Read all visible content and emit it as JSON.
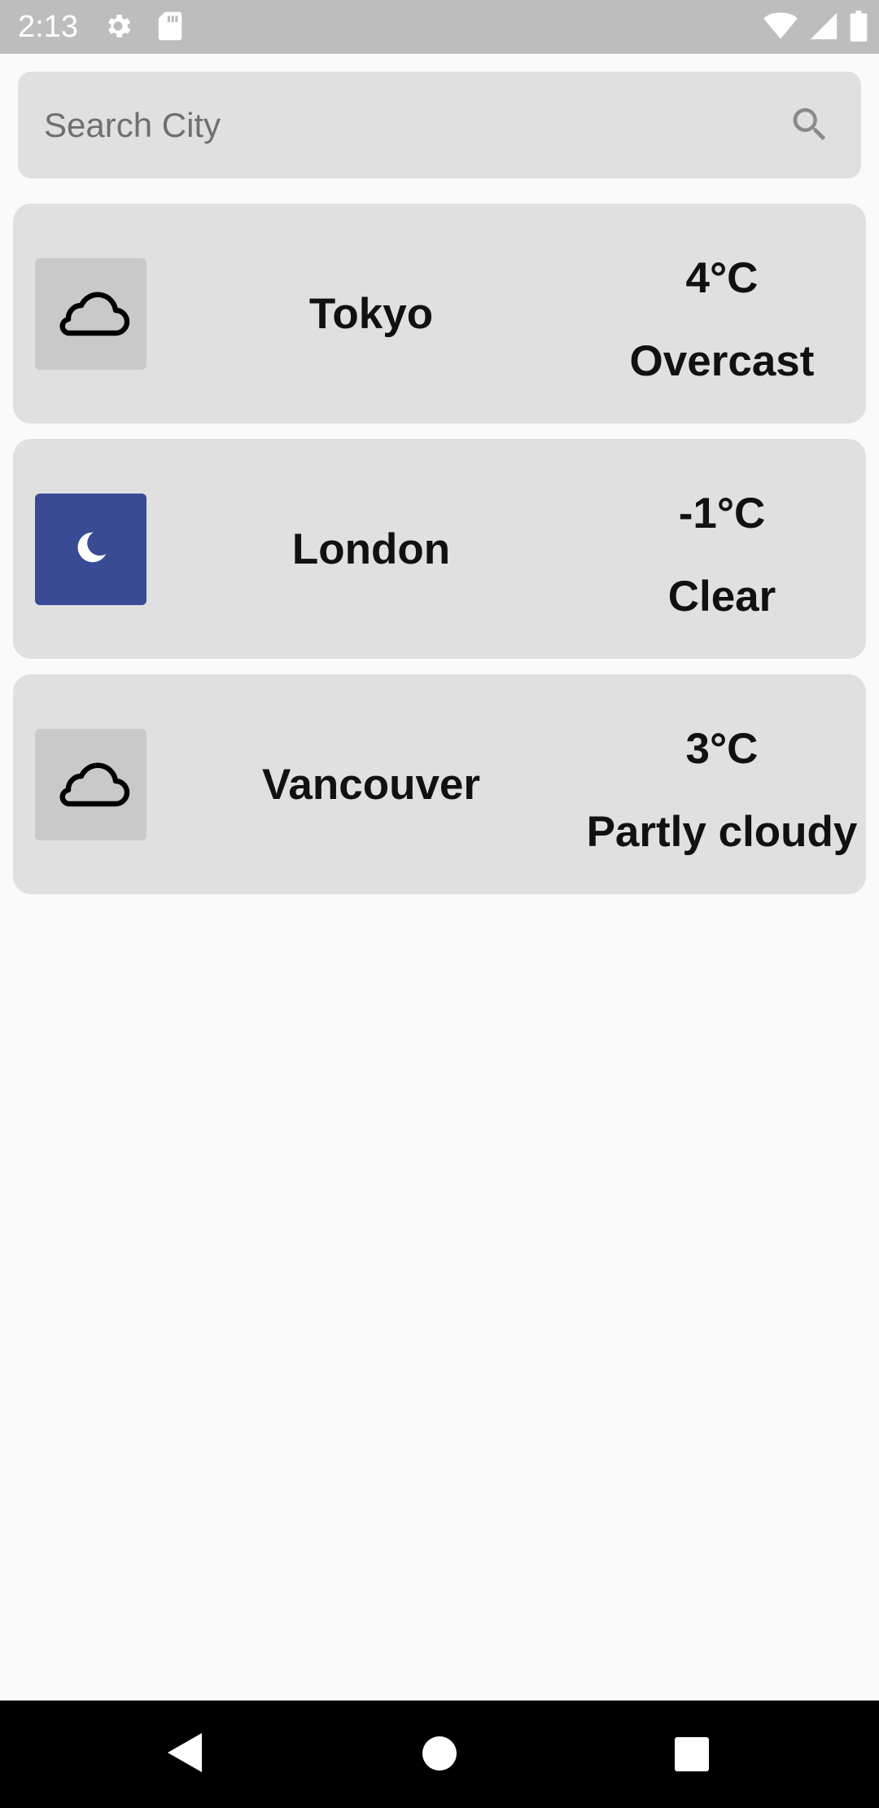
{
  "status_bar": {
    "time": "2:13",
    "left_icons": [
      "settings-icon",
      "sd-card-icon"
    ],
    "right_icons": [
      "wifi-icon",
      "signal-icon",
      "battery-icon"
    ]
  },
  "search": {
    "placeholder": "Search City",
    "value": "",
    "icon": "search-icon"
  },
  "cities": [
    {
      "name": "Tokyo",
      "temperature": "4°C",
      "condition": "Overcast",
      "icon": "cloud-icon",
      "icon_bg": "#c9c9c9"
    },
    {
      "name": "London",
      "temperature": "-1°C",
      "condition": "Clear",
      "icon": "moon-icon",
      "icon_bg": "#3a4b96"
    },
    {
      "name": "Vancouver",
      "temperature": "3°C",
      "condition": "Partly cloudy",
      "icon": "cloud-icon",
      "icon_bg": "#c9c9c9"
    }
  ],
  "nav_bar": {
    "buttons": [
      "back-icon",
      "home-icon",
      "recents-icon"
    ]
  },
  "colors": {
    "status_bar": "#bdbdbd",
    "card_bg": "#e0e0e0",
    "background": "#fafafa",
    "night_icon_bg": "#3a4b96"
  }
}
